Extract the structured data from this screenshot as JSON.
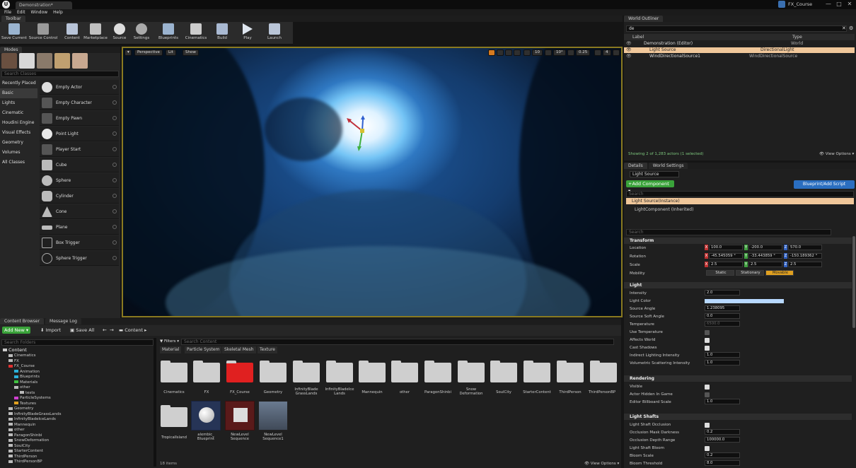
{
  "window": {
    "doc_tab": "Demonstration*",
    "project": "FX_Course",
    "controls": [
      "—",
      "□",
      "✕"
    ]
  },
  "menu": [
    "File",
    "Edit",
    "Window",
    "Help"
  ],
  "toolbar": {
    "tab": "Toolbar",
    "buttons": [
      "Save Current",
      "Source Control",
      "Content",
      "Marketplace",
      "Source",
      "Settings",
      "Blueprints",
      "Cinematics",
      "Build",
      "Play",
      "Launch"
    ]
  },
  "modes": {
    "tab": "Modes",
    "search_placeholder": "Search Classes",
    "categories": [
      "Recently Placed",
      "Basic",
      "Lights",
      "Cinematic",
      "Houdini Engine",
      "Visual Effects",
      "Geometry",
      "Volumes",
      "All Classes"
    ],
    "selected_category": "Basic",
    "items": [
      "Empty Actor",
      "Empty Character",
      "Empty Pawn",
      "Point Light",
      "Player Start",
      "Cube",
      "Sphere",
      "Cylinder",
      "Cone",
      "Plane",
      "Box Trigger",
      "Sphere Trigger"
    ]
  },
  "viewport": {
    "perspective": "Perspective",
    "lit": "Lit",
    "show": "Show",
    "snap_translate": "10",
    "snap_rotate": "10°",
    "snap_scale": "0.25",
    "camera_speed": "4"
  },
  "content_browser": {
    "tab": "Content Browser",
    "tab2": "Message Log",
    "add_new": "Add New",
    "import": "Import",
    "save_all": "Save All",
    "path": "Content",
    "search_folders": "Search Folders",
    "filters": "Filters",
    "search_content": "Search Content",
    "filter_chips": [
      "Material",
      "Particle System",
      "Skeletal Mesh",
      "Texture"
    ],
    "items_count": "18 items",
    "view_options": "View Options",
    "tree": [
      "Content",
      "Cinematics",
      "FX",
      "FX_Course",
      "Animation",
      "Blueprints",
      "Materials",
      "other",
      "tests",
      "ParticleSystems",
      "Textures",
      "Geometry",
      "InfinityBladeGrassLands",
      "InfinityBladeIceLands",
      "Mannequin",
      "other",
      "ParagonShinbi",
      "SnowDeformation",
      "SoulCity",
      "StarterContent",
      "ThirdPerson",
      "ThirdPersonBP"
    ],
    "assets_row1": [
      "Cinematics",
      "FX",
      "FX_Course",
      "Geometry",
      "InfinityBlade GrassLands",
      "InfinityBladeIce Lands",
      "Mannequin",
      "other",
      "ParagonShinbi",
      "Snow Deformation",
      "SoulCity",
      "StarterContent",
      "ThirdPerson",
      "ThirdPersonBP"
    ],
    "assets_row2": [
      "TropicalIsland",
      "alembic_ Blueprint",
      "NewLevel Sequence",
      "NewLevel Sequence1"
    ]
  },
  "outliner": {
    "tab": "World Outliner",
    "search": "de",
    "col_label": "Label",
    "col_type": "Type",
    "rows": [
      {
        "label": "Demonstration (Editor)",
        "type": "World"
      },
      {
        "label": "Light Source",
        "type": "DirectionalLight"
      },
      {
        "label": "WindDirectionalSource1",
        "type": "WindDirectionalSource"
      }
    ],
    "status": "Showing 2 of 1,283 actors (1 selected)",
    "view_options": "View Options"
  },
  "details": {
    "tab": "Details",
    "tab2": "World Settings",
    "name": "Light Source",
    "add_component": "+Add Component",
    "blueprint": "Blueprint/Add Script",
    "search": "Search",
    "instance": "Light Source(Instance)",
    "component": "LightComponent (Inherited)",
    "search2": "Search",
    "transform": {
      "title": "Transform",
      "location_label": "Location",
      "rotation_label": "Rotation",
      "scale_label": "Scale",
      "mobility_label": "Mobility",
      "location": [
        "100.0",
        "-200.0",
        "570.0"
      ],
      "rotation": [
        "-45.545059 °",
        "-33.443859 °",
        "-150.189362 °"
      ],
      "scale": [
        "2.5",
        "2.5",
        "2.5"
      ],
      "mobility": [
        "Static",
        "Stationary",
        "Movable"
      ]
    },
    "light": {
      "title": "Light",
      "rows": [
        {
          "n": "Intensity",
          "v": "2.0"
        },
        {
          "n": "Light Color",
          "v": ""
        },
        {
          "n": "Source Angle",
          "v": "1.238095"
        },
        {
          "n": "Source Soft Angle",
          "v": "0.0"
        },
        {
          "n": "Temperature",
          "v": "6500.0"
        },
        {
          "n": "Use Temperature",
          "v": ""
        },
        {
          "n": "Affects World",
          "v": ""
        },
        {
          "n": "Cast Shadows",
          "v": ""
        },
        {
          "n": "Indirect Lighting Intensity",
          "v": "1.0"
        },
        {
          "n": "Volumetric Scattering Intensity",
          "v": "1.0"
        }
      ]
    },
    "rendering": {
      "title": "Rendering",
      "rows": [
        {
          "n": "Visible",
          "v": ""
        },
        {
          "n": "Actor Hidden In Game",
          "v": ""
        },
        {
          "n": "Editor Billboard Scale",
          "v": "1.0"
        }
      ]
    },
    "shafts": {
      "title": "Light Shafts",
      "rows": [
        {
          "n": "Light Shaft Occlusion",
          "v": ""
        },
        {
          "n": "Occlusion Mask Darkness",
          "v": "0.2"
        },
        {
          "n": "Occlusion Depth Range",
          "v": "100000.0"
        },
        {
          "n": "Light Shaft Bloom",
          "v": ""
        },
        {
          "n": "Bloom Scale",
          "v": "0.2"
        },
        {
          "n": "Bloom Threshold",
          "v": "8.0"
        }
      ]
    }
  }
}
